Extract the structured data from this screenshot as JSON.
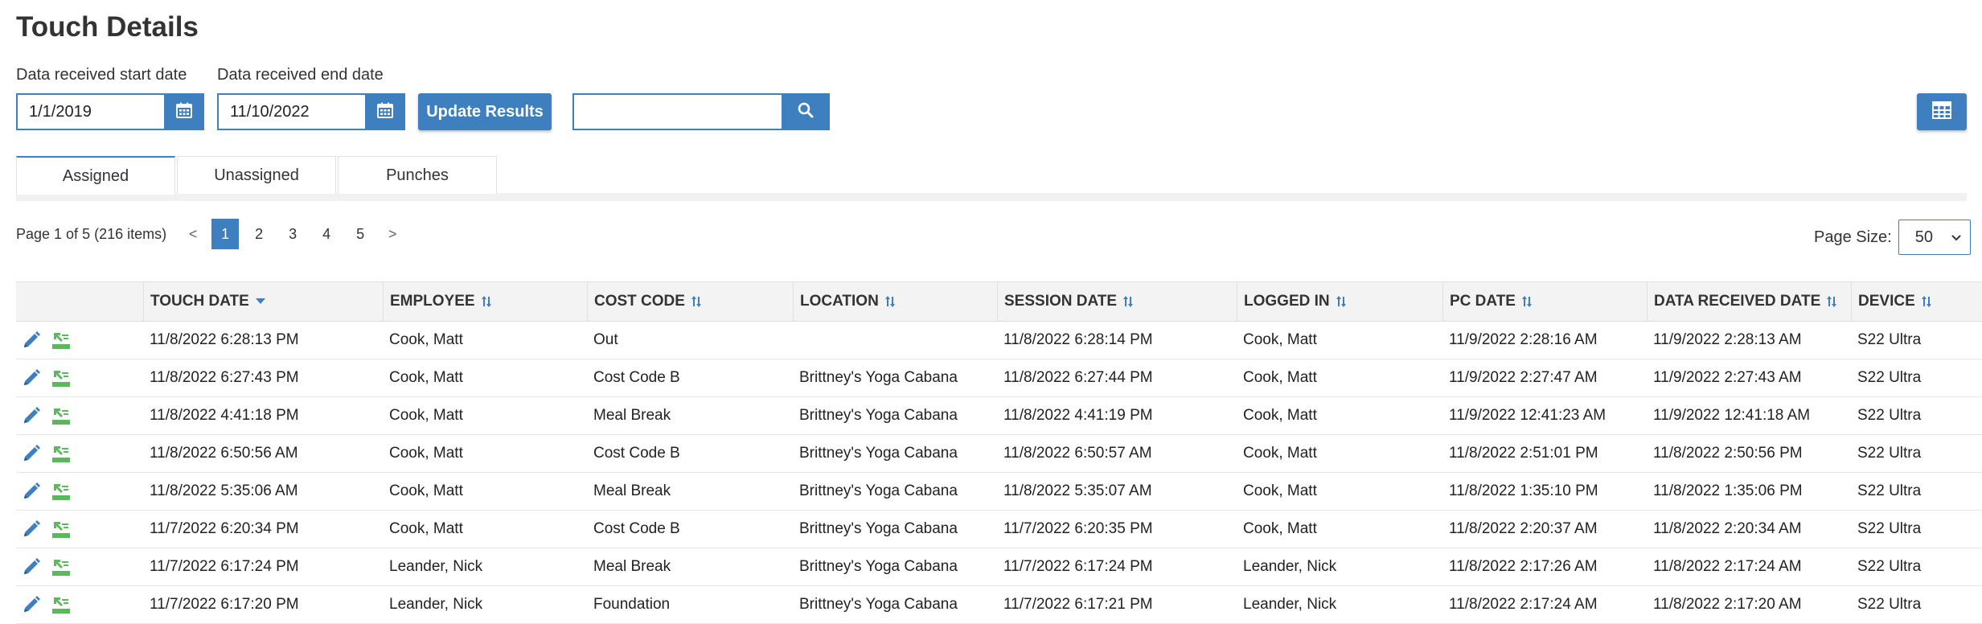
{
  "page": {
    "title": "Touch Details"
  },
  "filters": {
    "start_label": "Data received start date",
    "start_value": "1/1/2019",
    "end_label": "Data received end date",
    "end_value": "11/10/2022",
    "update_label": "Update Results",
    "search_value": ""
  },
  "icons": {
    "calendar": "calendar-icon",
    "search": "search-icon",
    "columns": "columns-grid-icon",
    "edit": "pencil-icon",
    "map": "map-pin-icon",
    "sort_down": "sort-desc-icon",
    "sort": "sort-icon",
    "chevron": "chevron-down-icon"
  },
  "colors": {
    "accent": "#3d7fbf",
    "map_icon": "#5cb85c"
  },
  "tabs": [
    {
      "label": "Assigned",
      "active": true
    },
    {
      "label": "Unassigned",
      "active": false
    },
    {
      "label": "Punches",
      "active": false
    }
  ],
  "pager": {
    "info": "Page 1 of 5 (216 items)",
    "prev": "<",
    "next": ">",
    "pages": [
      "1",
      "2",
      "3",
      "4",
      "5"
    ],
    "current": "1"
  },
  "page_size": {
    "label": "Page Size:",
    "value": "50"
  },
  "table": {
    "columns": [
      {
        "label": "",
        "sort": "none"
      },
      {
        "label": "TOUCH DATE",
        "sort": "desc"
      },
      {
        "label": "EMPLOYEE",
        "sort": "sortable"
      },
      {
        "label": "COST CODE",
        "sort": "sortable"
      },
      {
        "label": "LOCATION",
        "sort": "sortable"
      },
      {
        "label": "SESSION DATE",
        "sort": "sortable"
      },
      {
        "label": "LOGGED IN",
        "sort": "sortable"
      },
      {
        "label": "PC DATE",
        "sort": "sortable"
      },
      {
        "label": "DATA RECEIVED DATE",
        "sort": "sortable"
      },
      {
        "label": "DEVICE",
        "sort": "sortable"
      }
    ],
    "rows": [
      [
        "11/8/2022 6:28:13 PM",
        "Cook, Matt",
        "Out",
        "",
        "11/8/2022 6:28:14 PM",
        "Cook, Matt",
        "11/9/2022 2:28:16 AM",
        "11/9/2022 2:28:13 AM",
        "S22 Ultra"
      ],
      [
        "11/8/2022 6:27:43 PM",
        "Cook, Matt",
        "Cost Code B",
        "Brittney's Yoga Cabana",
        "11/8/2022 6:27:44 PM",
        "Cook, Matt",
        "11/9/2022 2:27:47 AM",
        "11/9/2022 2:27:43 AM",
        "S22 Ultra"
      ],
      [
        "11/8/2022 4:41:18 PM",
        "Cook, Matt",
        "Meal Break",
        "Brittney's Yoga Cabana",
        "11/8/2022 4:41:19 PM",
        "Cook, Matt",
        "11/9/2022 12:41:23 AM",
        "11/9/2022 12:41:18 AM",
        "S22 Ultra"
      ],
      [
        "11/8/2022 6:50:56 AM",
        "Cook, Matt",
        "Cost Code B",
        "Brittney's Yoga Cabana",
        "11/8/2022 6:50:57 AM",
        "Cook, Matt",
        "11/8/2022 2:51:01 PM",
        "11/8/2022 2:50:56 PM",
        "S22 Ultra"
      ],
      [
        "11/8/2022 5:35:06 AM",
        "Cook, Matt",
        "Meal Break",
        "Brittney's Yoga Cabana",
        "11/8/2022 5:35:07 AM",
        "Cook, Matt",
        "11/8/2022 1:35:10 PM",
        "11/8/2022 1:35:06 PM",
        "S22 Ultra"
      ],
      [
        "11/7/2022 6:20:34 PM",
        "Cook, Matt",
        "Cost Code B",
        "Brittney's Yoga Cabana",
        "11/7/2022 6:20:35 PM",
        "Cook, Matt",
        "11/8/2022 2:20:37 AM",
        "11/8/2022 2:20:34 AM",
        "S22 Ultra"
      ],
      [
        "11/7/2022 6:17:24 PM",
        "Leander, Nick",
        "Meal Break",
        "Brittney's Yoga Cabana",
        "11/7/2022 6:17:24 PM",
        "Leander, Nick",
        "11/8/2022 2:17:26 AM",
        "11/8/2022 2:17:24 AM",
        "S22 Ultra"
      ],
      [
        "11/7/2022 6:17:20 PM",
        "Leander, Nick",
        "Foundation",
        "Brittney's Yoga Cabana",
        "11/7/2022 6:17:21 PM",
        "Leander, Nick",
        "11/8/2022 2:17:24 AM",
        "11/8/2022 2:17:20 AM",
        "S22 Ultra"
      ]
    ]
  }
}
